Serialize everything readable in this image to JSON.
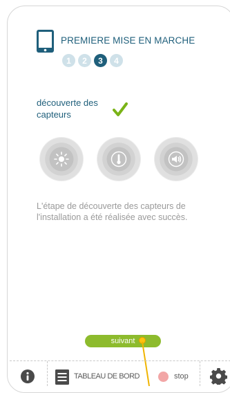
{
  "header": {
    "title": "PREMIERE MISE EN MARCHE",
    "icon": "smartphone-icon",
    "steps": [
      "1",
      "2",
      "3",
      "4"
    ],
    "active_step": "3"
  },
  "section": {
    "label": "découverte des capteurs",
    "status_icon": "checkmark-icon"
  },
  "sensors": [
    {
      "icon": "light-sensor-icon"
    },
    {
      "icon": "temperature-sensor-icon"
    },
    {
      "icon": "sound-sensor-icon"
    }
  ],
  "description": "L'étape de découverte des capteurs de l'installation a été réalisée avec succès.",
  "next_button": {
    "label": "suivant"
  },
  "bottombar": {
    "dashboard_label": "TABLEAU DE BORD",
    "stop_label": "stop"
  },
  "colors": {
    "primary": "#1f5f7b",
    "step_inactive": "#cfe1e9",
    "accent_green": "#8dbb2d",
    "check_green": "#7ab317",
    "stop_red": "#f2a6a6",
    "text_gray": "#9a9a9a",
    "cursor": "#ffc20e"
  }
}
